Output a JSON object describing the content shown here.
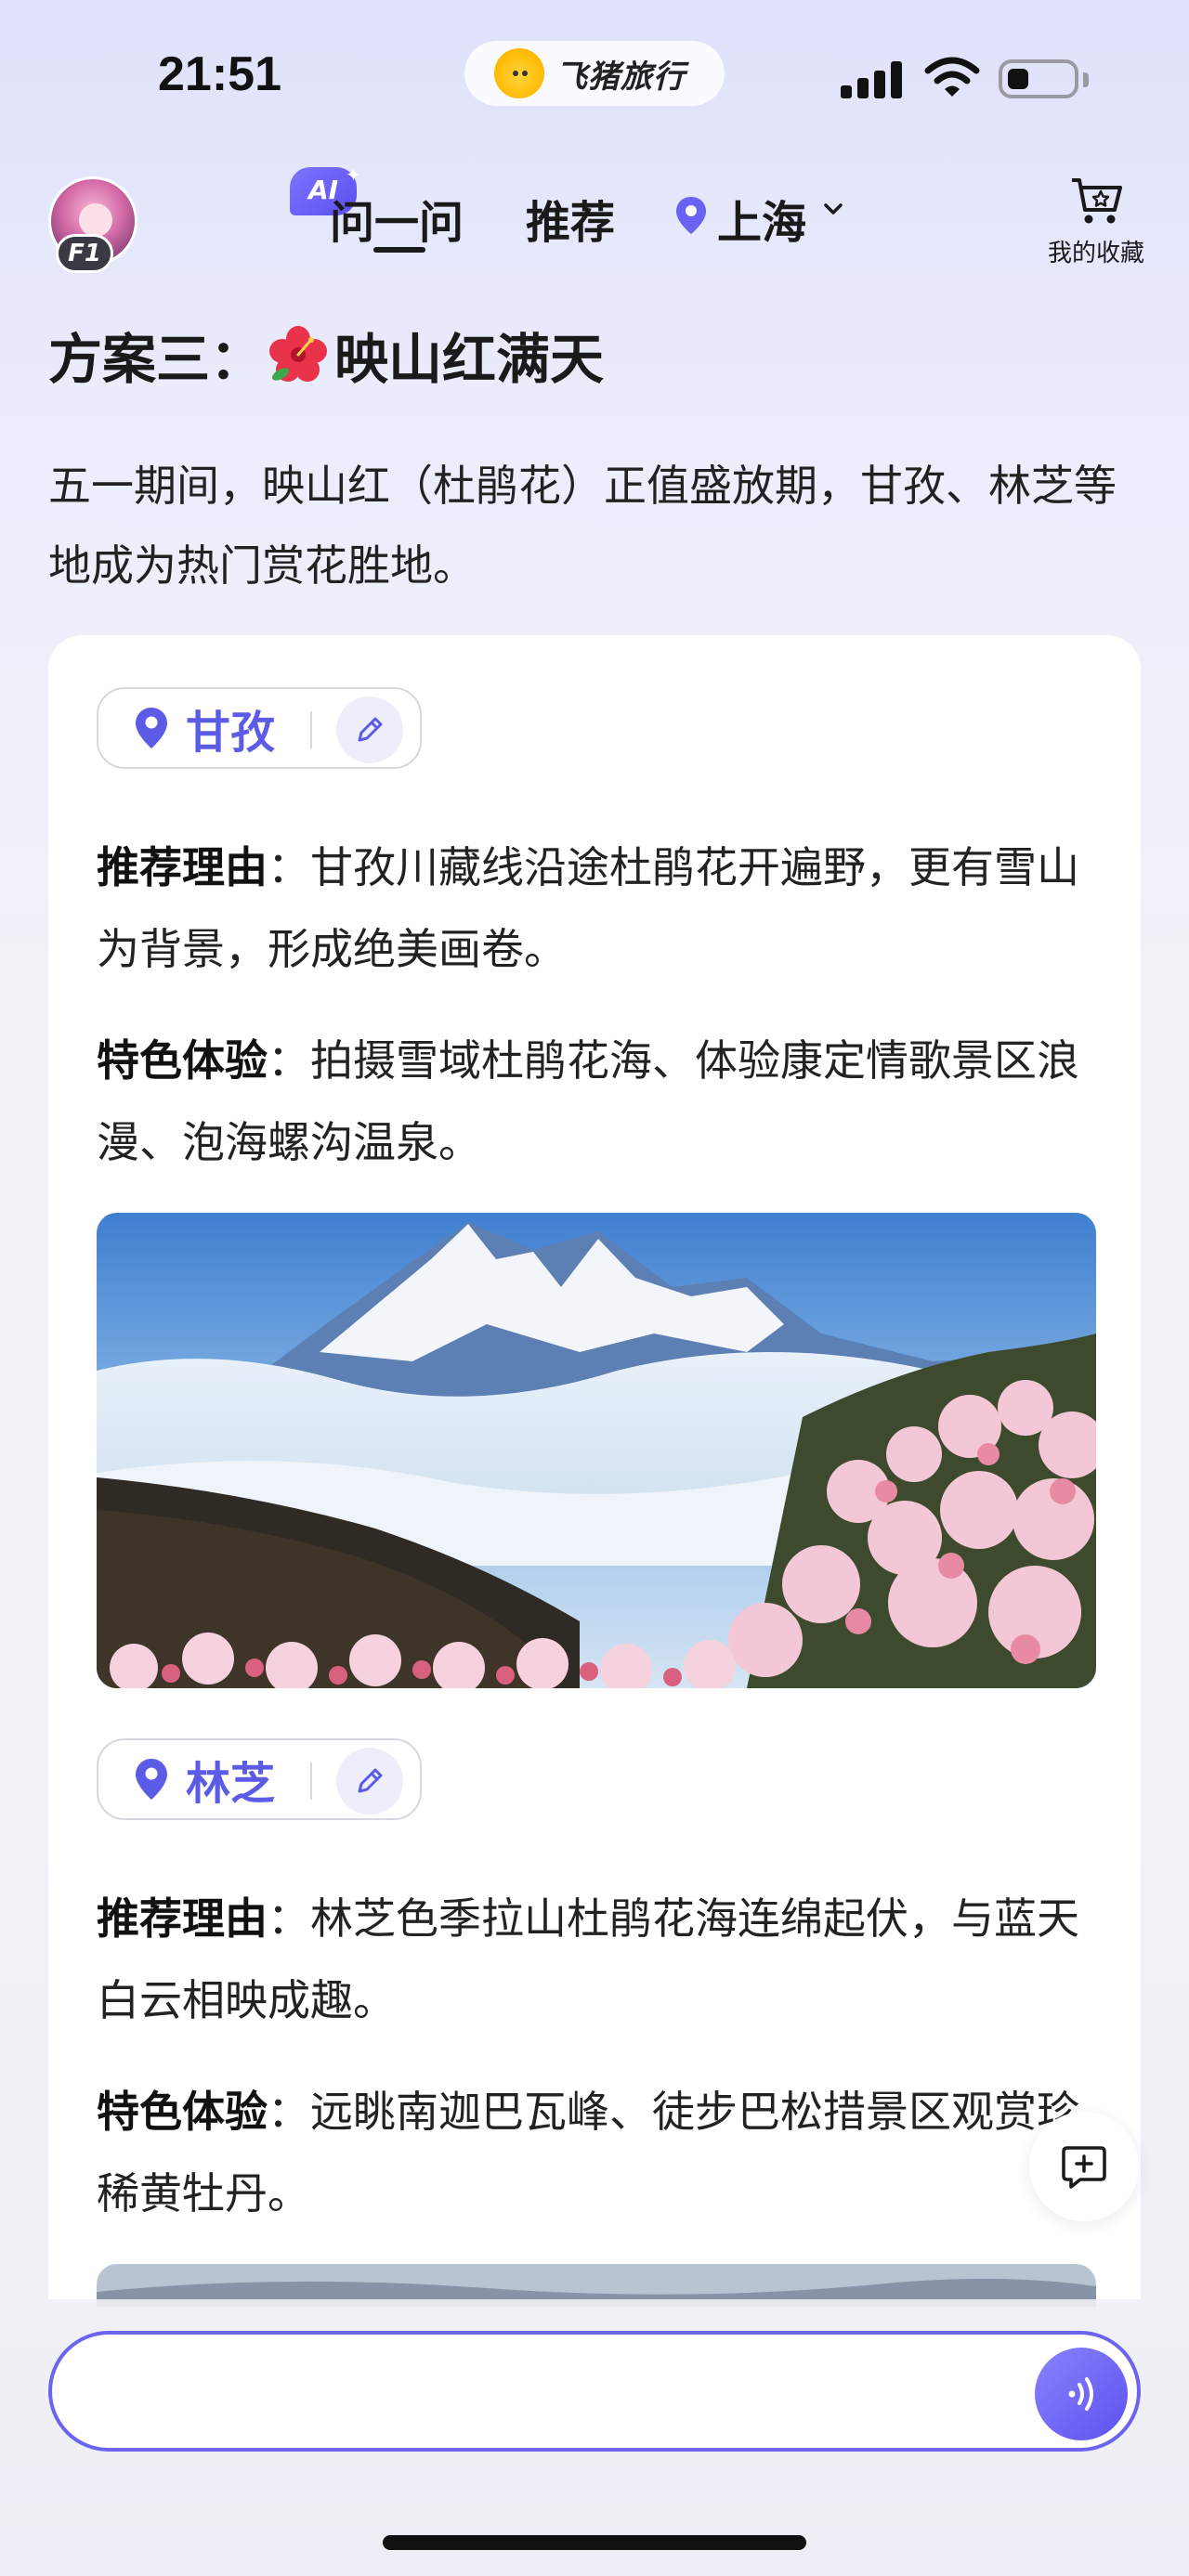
{
  "status_bar": {
    "time": "21:51",
    "app_name": "飞猪旅行"
  },
  "nav": {
    "avatar_badge": "F1",
    "ai_badge": "AI",
    "tab_ask": "问一问",
    "tab_recommend": "推荐",
    "location": "上海",
    "favorites_label": "我的收藏"
  },
  "content": {
    "plan_title_prefix": "方案三：",
    "plan_title_text": "映山红满天",
    "intro": "五一期间，映山红（杜鹃花）正值盛放期，甘孜、林芝等地成为热门赏花胜地。",
    "destinations": [
      {
        "name": "甘孜",
        "reason_label": "推荐理由",
        "reason": "：甘孜川藏线沿途杜鹃花开遍野，更有雪山为背景，形成绝美画卷。",
        "experience_label": "特色体验",
        "experience": "：拍摄雪域杜鹃花海、体验康定情歌景区浪漫、泡海螺沟温泉。"
      },
      {
        "name": "林芝",
        "reason_label": "推荐理由",
        "reason": "：林芝色季拉山杜鹃花海连绵起伏，与蓝天白云相映成趣。",
        "experience_label": "特色体验",
        "experience": "：远眺南迦巴瓦峰、徒步巴松措景区观赏珍稀黄牡丹。"
      }
    ]
  },
  "icons": {
    "pin": "location-pin-icon",
    "edit": "pencil-icon",
    "cart": "cart-star-icon",
    "chat_add": "chat-add-icon",
    "voice": "voice-wave-icon"
  },
  "colors": {
    "accent": "#5b5be6",
    "input_border": "#6c63f0",
    "voice_button": "#6a60f2"
  }
}
